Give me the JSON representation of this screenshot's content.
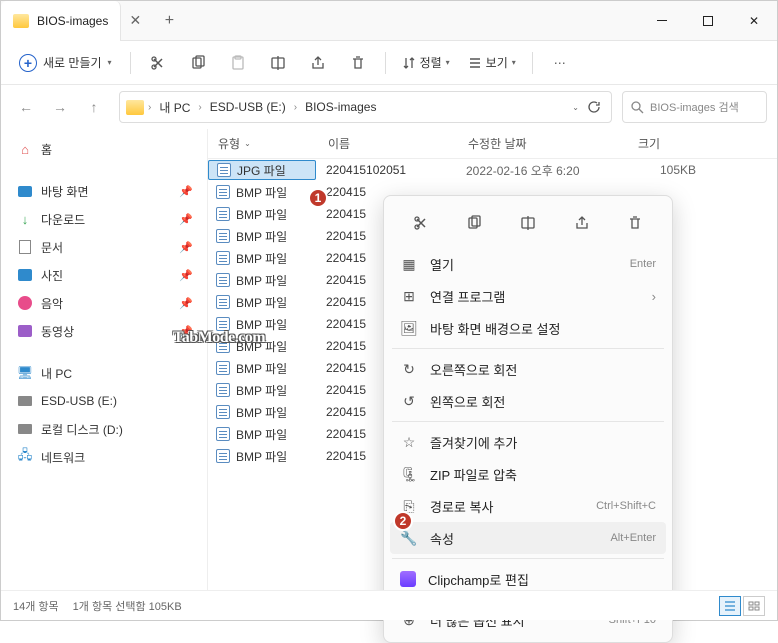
{
  "window": {
    "title": "BIOS-images"
  },
  "toolbar": {
    "new_label": "새로 만들기",
    "sort_label": "정렬",
    "view_label": "보기"
  },
  "address": {
    "seg1": "내 PC",
    "seg2": "ESD-USB (E:)",
    "seg3": "BIOS-images"
  },
  "search": {
    "placeholder": "BIOS-images 검색"
  },
  "sidebar": {
    "home": "홈",
    "desktop": "바탕 화면",
    "downloads": "다운로드",
    "documents": "문서",
    "pictures": "사진",
    "music": "음악",
    "videos": "동영상",
    "thispc": "내 PC",
    "drive_e": "ESD-USB (E:)",
    "drive_d": "로컬 디스크 (D:)",
    "network": "네트워크"
  },
  "columns": {
    "type": "유형",
    "name": "이름",
    "date": "수정한 날짜",
    "size": "크기"
  },
  "rows": [
    {
      "type": "JPG 파일",
      "name": "220415102051",
      "date": "2022-02-16 오후 6:20",
      "size": "105KB",
      "sel": true
    },
    {
      "type": "BMP 파일",
      "name": "220415"
    },
    {
      "type": "BMP 파일",
      "name": "220415"
    },
    {
      "type": "BMP 파일",
      "name": "220415"
    },
    {
      "type": "BMP 파일",
      "name": "220415"
    },
    {
      "type": "BMP 파일",
      "name": "220415"
    },
    {
      "type": "BMP 파일",
      "name": "220415"
    },
    {
      "type": "BMP 파일",
      "name": "220415"
    },
    {
      "type": "BMP 파일",
      "name": "220415"
    },
    {
      "type": "BMP 파일",
      "name": "220415"
    },
    {
      "type": "BMP 파일",
      "name": "220415"
    },
    {
      "type": "BMP 파일",
      "name": "220415"
    },
    {
      "type": "BMP 파일",
      "name": "220415"
    },
    {
      "type": "BMP 파일",
      "name": "220415"
    }
  ],
  "ctx": {
    "open": "열기",
    "open_sc": "Enter",
    "openwith": "연결 프로그램",
    "setbg": "바탕 화면 배경으로 설정",
    "rotright": "오른쪽으로 회전",
    "rotleft": "왼쪽으로 회전",
    "fav": "즐겨찾기에 추가",
    "zip": "ZIP 파일로 압축",
    "copypath": "경로로 복사",
    "copypath_sc": "Ctrl+Shift+C",
    "props": "속성",
    "props_sc": "Alt+Enter",
    "clip": "Clipchamp로 편집",
    "more": "더 많은 옵션 표시",
    "more_sc": "Shift+F10"
  },
  "status": {
    "count": "14개 항목",
    "sel": "1개 항목 선택함 105KB"
  },
  "badges": {
    "b1": "1",
    "b2": "2"
  },
  "watermark": "TabMode.com"
}
